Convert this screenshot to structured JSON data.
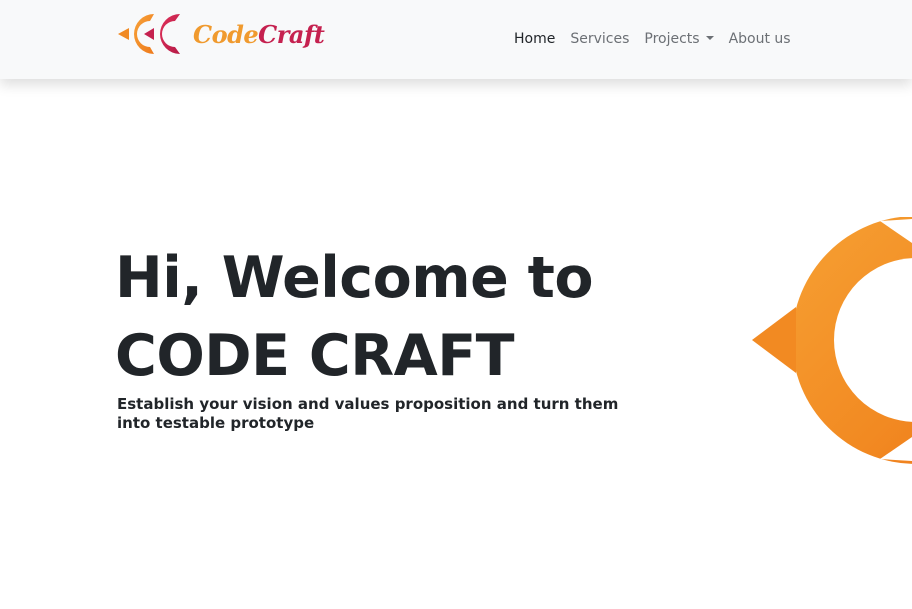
{
  "brand": {
    "name_part1": "Code",
    "name_part2": "Craft",
    "logo_icon": "cc-logo-icon"
  },
  "nav": {
    "items": [
      {
        "label": "Home",
        "active": true
      },
      {
        "label": "Services",
        "active": false
      },
      {
        "label": "Projects",
        "active": false,
        "dropdown": true
      },
      {
        "label": "About us",
        "active": false
      }
    ]
  },
  "hero": {
    "title_line1": "Hi, Welcome to",
    "title_line2": "CODE CRAFT",
    "subtitle": "Establish your vision and values proposition and turn them into testable prototype",
    "art_icon": "cc-logo-art"
  },
  "colors": {
    "orange": "#f08a24",
    "crimson": "#c5214f",
    "text_dark": "#212529",
    "nav_muted": "#6c7075",
    "navbar_bg": "#f8f9fa"
  }
}
